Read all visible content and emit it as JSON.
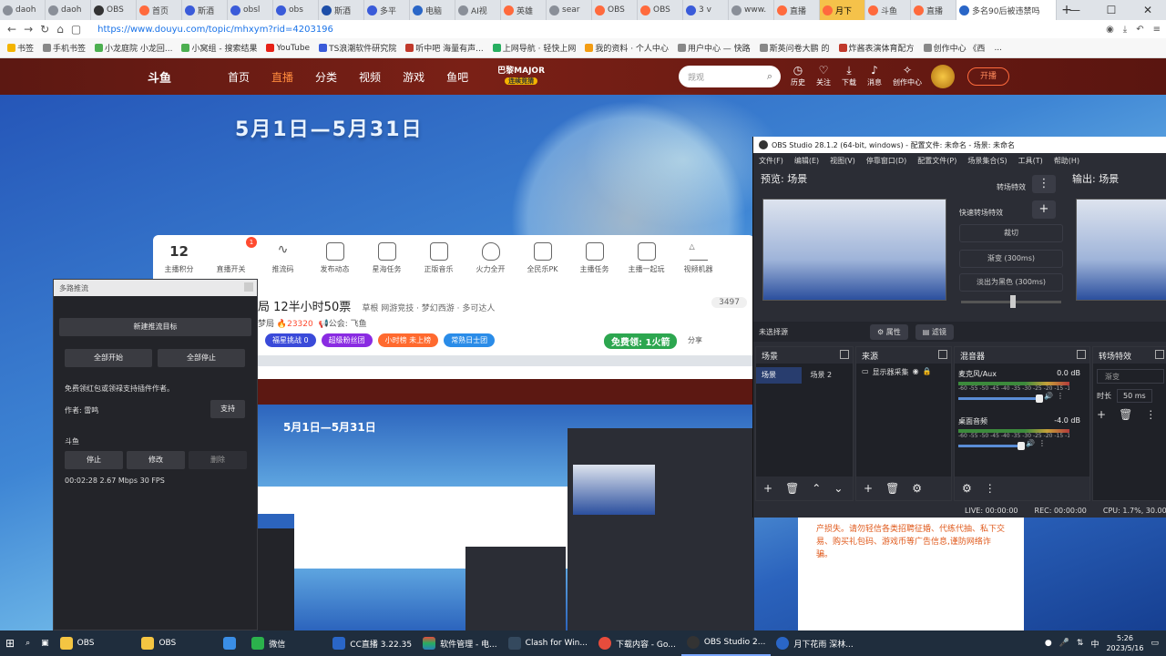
{
  "browser": {
    "tabs": [
      "daoh",
      "daoh",
      "OBS",
      "首页",
      "斯酒",
      "obsl",
      "obs",
      "斯酒",
      "多平",
      "电脑",
      "AI视",
      "英雄",
      "sear",
      "OBS",
      "OBS",
      "3 v",
      "www.",
      "直播",
      "月下",
      "斗鱼",
      "直播",
      "多名90后被违禁吗",
      "+"
    ],
    "url": "https://www.douyu.com/topic/mhxym?rid=4203196",
    "bookmarks": [
      "书签",
      "手机书签",
      "小龙庭院 小龙回...",
      "小窝组 - 搜索结果",
      "YouTube",
      "TS浪潮软件研究院",
      "听中吧 海量有声...",
      "上网导航 · 轻快上网",
      "我的资料 · 个人中心",
      "用户中心 — 快路",
      "斯英问卷大鹏 的",
      "炸酱表演体育配方",
      "创作中心 《西",
      "..."
    ]
  },
  "douyu": {
    "logo": "斗鱼",
    "nav": [
      "首页",
      "直播",
      "分类",
      "视频",
      "游戏",
      "鱼吧"
    ],
    "major_title": "巴黎MAJOR",
    "major_sub": "连续竞猜",
    "search_placeholder": "觊观",
    "header_icons": [
      "历史",
      "关注",
      "下载",
      "消息",
      "创作中心"
    ],
    "kaibo": "开播",
    "date_banner": "5月1日—5月31日",
    "anchor_bar": {
      "points_value": "12",
      "points_label": "主播积分",
      "open_badge": "1",
      "items": [
        "直播开关",
        "推流码",
        "发布动态",
        "星海任务",
        "正版音乐",
        "火力全开",
        "全民乐PK",
        "主播任务",
        "主播一起玩",
        "视频机器"
      ]
    },
    "room": {
      "title": "局 12半小时50票",
      "title_small": "草根  网游竞技 · 梦幻西游 · 多可达人",
      "meta_prefix": "梦局",
      "hot": "23320",
      "notice": "公会: 飞鱼",
      "count": "3497",
      "tags": [
        "福星挑战 0",
        "超级粉丝团",
        "小时榜 未上榜",
        "常熟日士团"
      ],
      "free": "免费领: 1火箭",
      "share": "分享"
    },
    "notice_text": "产损失。请勿轻信各类招聘征婚、代练代抽、私下交易、购买礼包码、游戏币等广告信息,谨防网络诈骗。"
  },
  "multipush": {
    "title": "多路推流",
    "new_target": "新建推流目标",
    "start_all": "全部开始",
    "stop_all": "全部停止",
    "sponsor_text": "免费领红包或领禄支持插件作者。",
    "author": "作者: 雷鸣",
    "support": "支持",
    "target_name": "斗鱼",
    "stop": "停止",
    "edit": "修改",
    "delete": "删除",
    "stats": "00:02:28  2.67 Mbps  30 FPS"
  },
  "obs": {
    "title": "OBS Studio 28.1.2 (64-bit, windows) - 配置文件: 未命名 - 场景: 未命名",
    "menu": [
      "文件(F)",
      "编辑(E)",
      "视图(V)",
      "停靠窗口(D)",
      "配置文件(P)",
      "场景集合(S)",
      "工具(T)",
      "帮助(H)"
    ],
    "preview_label": "预览: 场景",
    "output_label": "输出: 场景",
    "transition_btn": "转场特效",
    "quick_transitions": "快速转场特效",
    "qt_options": [
      "裁切",
      "渐变 (300ms)",
      "淡出为黑色 (300ms)"
    ],
    "controls_bar": {
      "no_source": "未选择源",
      "properties": "属性",
      "filters": "滤镜"
    },
    "scenes": {
      "header": "场景",
      "items": [
        "场景",
        "场景 2"
      ]
    },
    "sources": {
      "header": "来源",
      "items": [
        "显示器采集"
      ]
    },
    "mixer": {
      "header": "混音器",
      "channels": [
        {
          "name": "麦克风/Aux",
          "db": "0.0 dB"
        },
        {
          "name": "桌面音频",
          "db": "-4.0 dB"
        }
      ],
      "ticks": "-60 -55 -50 -45 -40 -35 -30 -25 -20 -15 -10 -5 0"
    },
    "transitions": {
      "header": "转场特效",
      "select": "渐变",
      "duration_label": "时长",
      "duration": "50 ms"
    },
    "status": {
      "live": "LIVE: 00:00:00",
      "rec": "REC: 00:00:00",
      "cpu": "CPU: 1.7%, 30.00 fps"
    }
  },
  "taskbar": {
    "items": [
      "OBS",
      "OBS",
      "",
      "微信",
      "CC直播 3.22.35",
      "软件管理 - 电...",
      "Clash for Win...",
      "下载内容 - Go...",
      "OBS Studio 2...",
      "月下花雨 深林..."
    ],
    "ime": "中",
    "time": "5:26",
    "date": "2023/5/16"
  },
  "colors": {
    "douyu_red": "#7a2016",
    "douyu_orange": "#ff7a2f",
    "obs_bg": "#2b2d35",
    "taskbar": "#1f2d3d"
  }
}
